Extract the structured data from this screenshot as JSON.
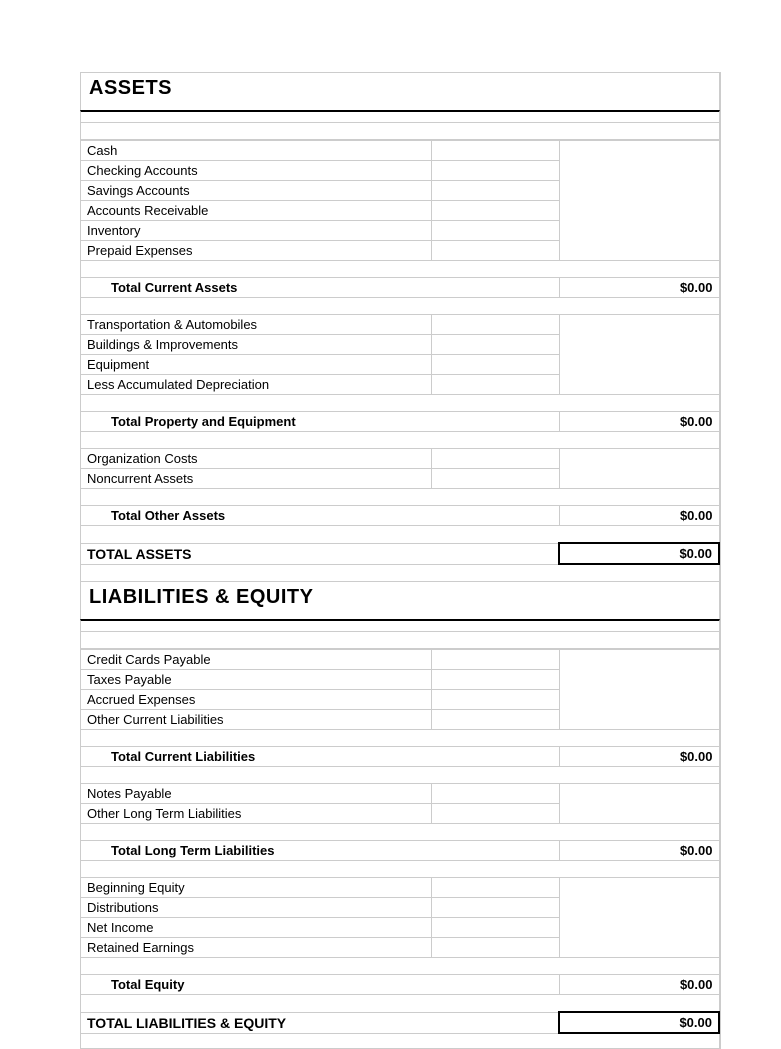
{
  "assets": {
    "title": "ASSETS",
    "current_items": [
      "Cash",
      "Checking Accounts",
      "Savings Accounts",
      "Accounts Receivable",
      "Inventory",
      "Prepaid Expenses"
    ],
    "total_current_label": "Total Current Assets",
    "total_current_value": "$0.00",
    "property_items": [
      "Transportation & Automobiles",
      "Buildings & Improvements",
      "Equipment",
      "Less Accumulated Depreciation"
    ],
    "total_property_label": "Total Property and Equipment",
    "total_property_value": "$0.00",
    "other_items": [
      "Organization Costs",
      "Noncurrent Assets"
    ],
    "total_other_label": "Total Other Assets",
    "total_other_value": "$0.00",
    "grand_total_label": "TOTAL ASSETS",
    "grand_total_value": "$0.00"
  },
  "liabilities": {
    "title": "LIABILITIES & EQUITY",
    "current_items": [
      "Credit Cards Payable",
      "Taxes Payable",
      "Accrued Expenses",
      "Other Current Liabilities"
    ],
    "total_current_label": "Total Current Liabilities",
    "total_current_value": "$0.00",
    "longterm_items": [
      "Notes Payable",
      "Other Long Term Liabilities"
    ],
    "total_longterm_label": "Total Long Term Liabilities",
    "total_longterm_value": "$0.00",
    "equity_items": [
      "Beginning Equity",
      "Distributions",
      "Net Income",
      "Retained Earnings"
    ],
    "total_equity_label": "Total Equity",
    "total_equity_value": "$0.00",
    "grand_total_label": "TOTAL LIABILITIES & EQUITY",
    "grand_total_value": "$0.00"
  }
}
